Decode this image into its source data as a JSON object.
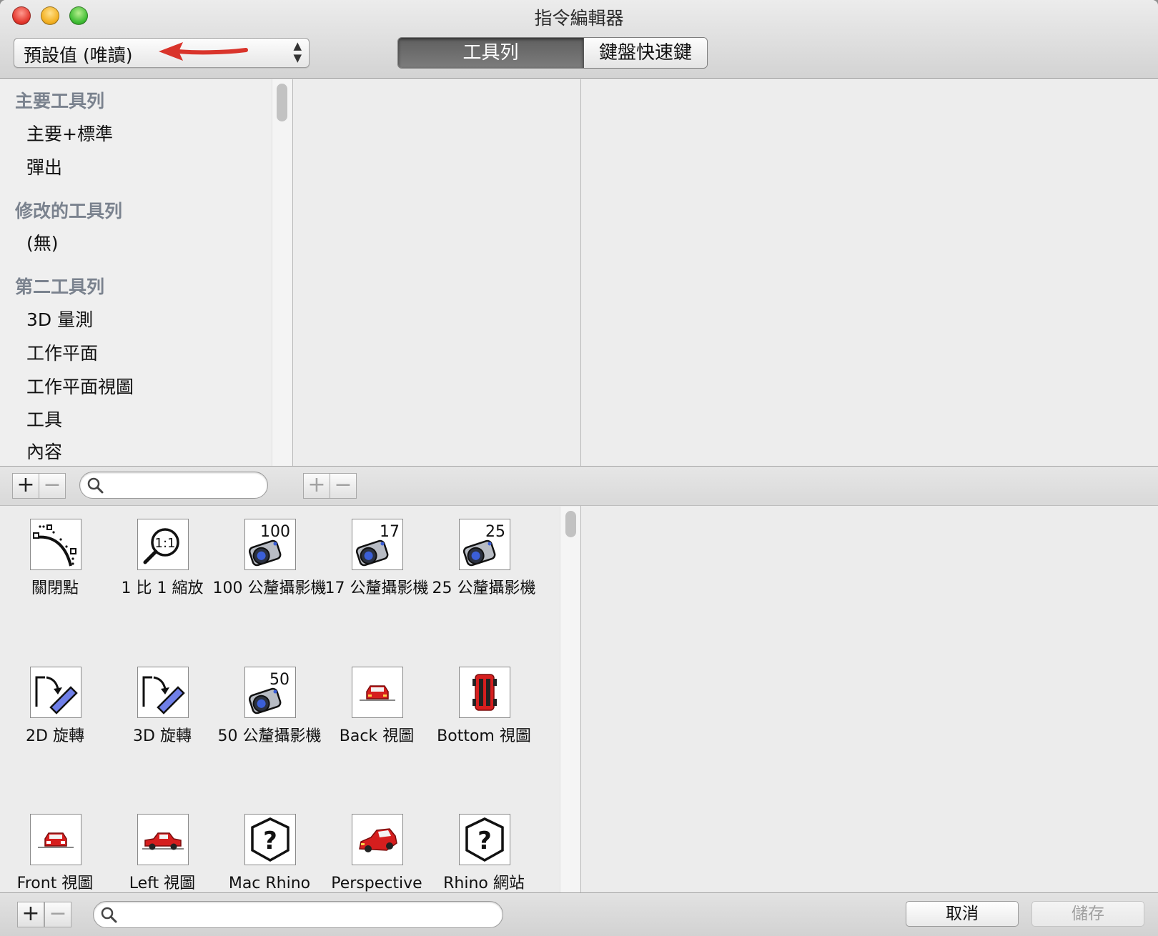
{
  "window": {
    "title": "指令編輯器"
  },
  "preset": {
    "value": "預設值 (唯讀)",
    "arrows": "▲\n▼"
  },
  "tabs": {
    "toolbars": "工具列",
    "keyboard_shortcuts": "鍵盤快速鍵"
  },
  "toolbar_list": {
    "sections": [
      {
        "header": "主要工具列",
        "items": [
          "主要+標準",
          "彈出"
        ]
      },
      {
        "header": "修改的工具列",
        "items": [
          "(無)"
        ]
      },
      {
        "header": "第二工具列",
        "items": [
          "3D 量測",
          "工作平面",
          "工作平面視圖",
          "工具",
          "內容"
        ]
      }
    ]
  },
  "buttons": {
    "add": "+",
    "remove": "−",
    "cancel": "取消",
    "save": "儲存"
  },
  "commands": [
    {
      "label": "關閉點",
      "icon": "close-point-icon"
    },
    {
      "label": "1 比 1 縮放",
      "icon": "zoom-1to1-icon"
    },
    {
      "label": "100 公釐攝影機",
      "icon": "camera-100mm-icon",
      "badge": "100"
    },
    {
      "label": "17 公釐攝影機",
      "icon": "camera-17mm-icon",
      "badge": "17"
    },
    {
      "label": "25 公釐攝影機",
      "icon": "camera-25mm-icon",
      "badge": "25"
    },
    {
      "label": "2D 旋轉",
      "icon": "rotate-2d-icon"
    },
    {
      "label": "3D 旋轉",
      "icon": "rotate-3d-icon"
    },
    {
      "label": "50 公釐攝影機",
      "icon": "camera-50mm-icon",
      "badge": "50"
    },
    {
      "label": "Back 視圖",
      "icon": "back-view-car-icon"
    },
    {
      "label": "Bottom 視圖",
      "icon": "bottom-view-car-icon"
    },
    {
      "label": "Front 視圖",
      "icon": "front-view-car-icon"
    },
    {
      "label": "Left 視圖",
      "icon": "left-view-car-icon"
    },
    {
      "label": "Mac Rhino",
      "icon": "help-question-icon"
    },
    {
      "label": "Perspective",
      "icon": "perspective-car-icon"
    },
    {
      "label": "Rhino 網站",
      "icon": "help-question-icon"
    }
  ],
  "colors": {
    "accent_red": "#d9342b",
    "section_header": "#7a828e",
    "selected_tab": "#666666"
  }
}
